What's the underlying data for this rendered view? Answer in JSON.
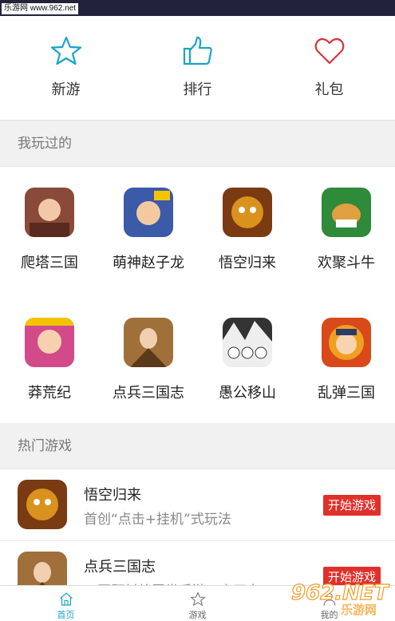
{
  "watermark_top": "乐游网 www.962.net",
  "quicknav": [
    {
      "label": "新游",
      "icon": "star-icon"
    },
    {
      "label": "排行",
      "icon": "thumbs-up-icon"
    },
    {
      "label": "礼包",
      "icon": "heart-icon"
    }
  ],
  "played": {
    "header": "我玩过的",
    "games": [
      {
        "name": "爬塔三国",
        "color": "#8a4a3a"
      },
      {
        "name": "萌神赵子龙",
        "color": "#3b5aa8"
      },
      {
        "name": "悟空归来",
        "color": "#b8741e"
      },
      {
        "name": "欢聚斗牛",
        "color": "#2f8a3a"
      },
      {
        "name": "莽荒纪",
        "color": "#d24a8a"
      },
      {
        "name": "点兵三国志",
        "color": "#8a5a2a"
      },
      {
        "name": "愚公移山",
        "color": "#777777"
      },
      {
        "name": "乱弹三国",
        "color": "#d84a1a"
      }
    ]
  },
  "hot": {
    "header": "热门游戏",
    "items": [
      {
        "title": "悟空归来",
        "desc": "首创“点击+挂机”式玩法",
        "button": "开始游戏",
        "color": "#b8741e"
      },
      {
        "title": "点兵三国志",
        "desc": "三国题材放置类手游，启用自",
        "button": "开始游戏",
        "color": "#8a5a2a"
      }
    ]
  },
  "tabs": [
    {
      "label": "首页",
      "icon": "home-icon"
    },
    {
      "label": "游戏",
      "icon": "star-icon"
    },
    {
      "label": "我的",
      "icon": "user-icon"
    }
  ],
  "accent": "#1aa3c9",
  "button_color": "#e0302b",
  "logo_text": "962.NET",
  "logo_sub": "乐游网"
}
